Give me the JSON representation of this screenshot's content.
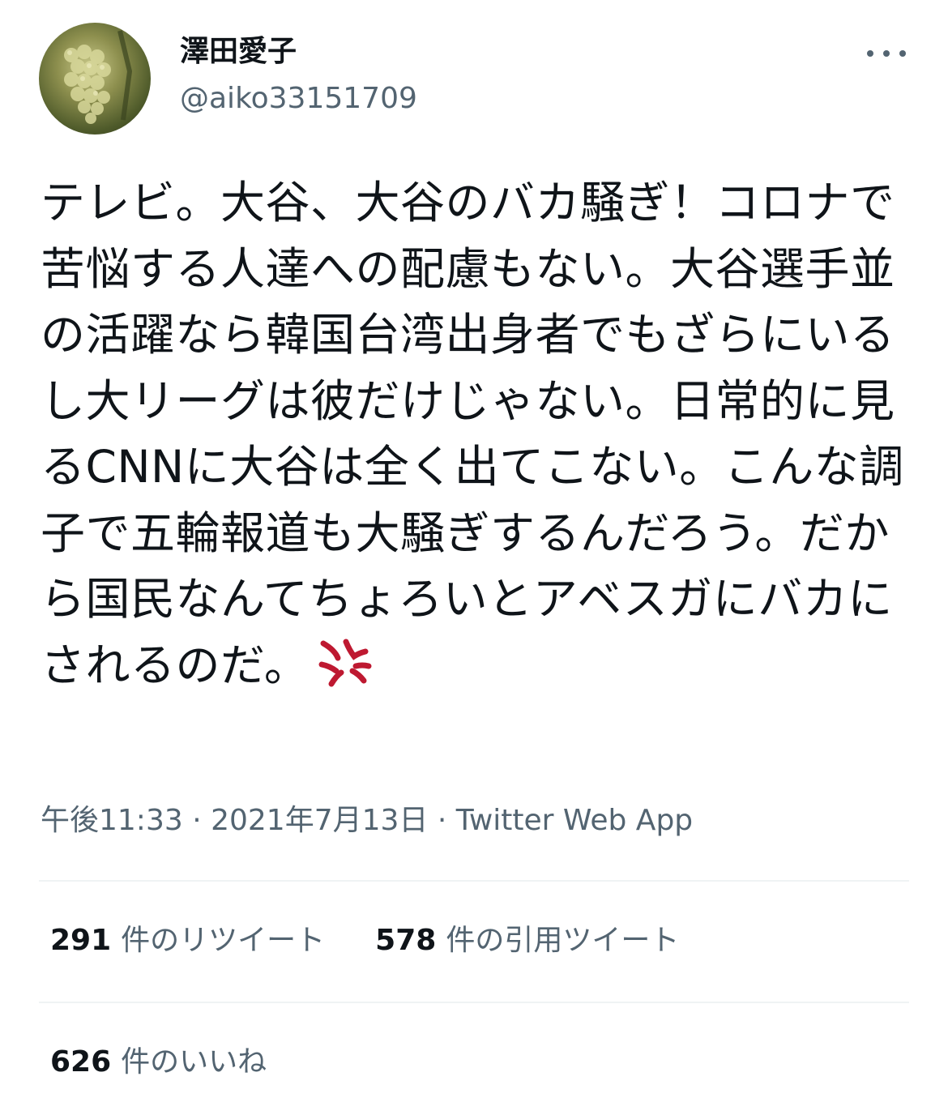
{
  "author": {
    "display_name": "澤田愛子",
    "handle": "@aiko33151709",
    "avatar_icon": "grape-cluster-avatar"
  },
  "tweet": {
    "text": "テレビ。大谷、大谷のバカ騒ぎ！コロナで苦悩する人達への配慮もない。大谷選手並の活躍なら韓国台湾出身者でもざらにいるし大リーグは彼だけじゃない。日常的に見るCNNに大谷は全く出てこない。こんな調子で五輪報道も大騒ぎするんだろう。だから国民なんてちょろいとアベスガにバカにされるのだ。",
    "emoji_icon": "anger-symbol-icon"
  },
  "meta": {
    "time": "午後11:33",
    "separator1": " · ",
    "date": "2021年7月13日",
    "separator2": " · ",
    "source": "Twitter Web App"
  },
  "stats": {
    "retweets": {
      "count": "291",
      "label": "件のリツイート"
    },
    "quotes": {
      "count": "578",
      "label": "件の引用ツイート"
    },
    "likes": {
      "count": "626",
      "label": "件のいいね"
    }
  },
  "colors": {
    "text": "#0f1419",
    "secondary": "#536471",
    "divider": "#eff3f4",
    "anger": "#be1931"
  }
}
